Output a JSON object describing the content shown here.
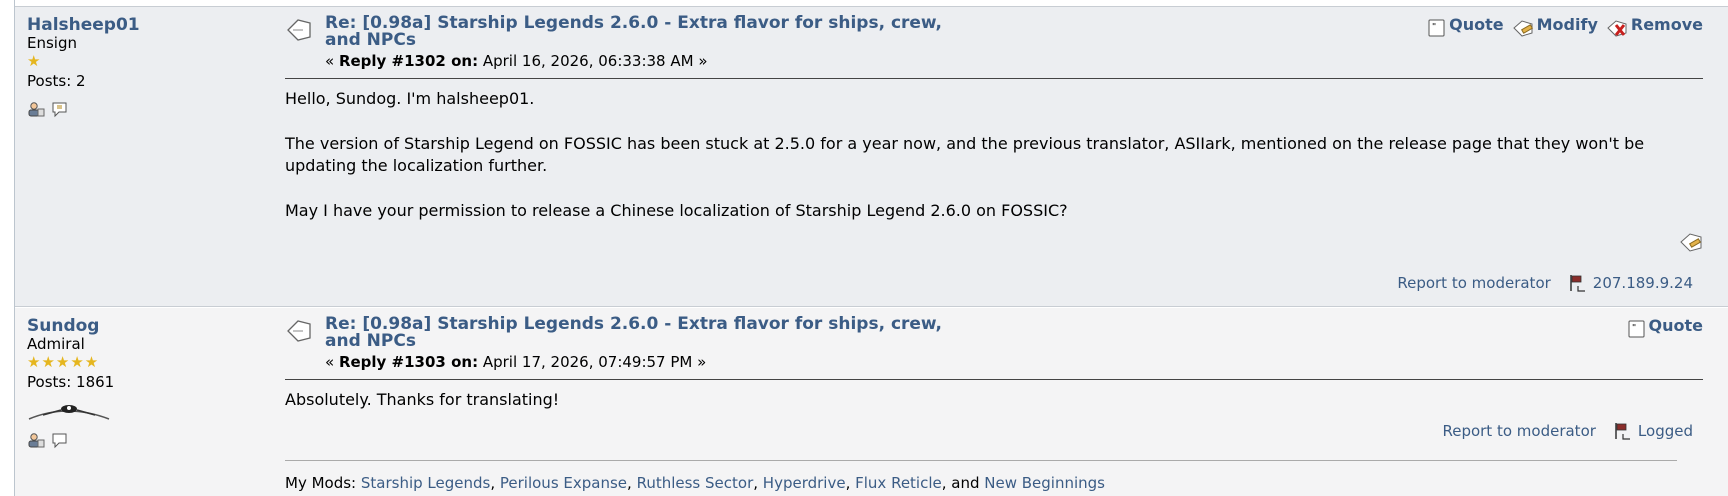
{
  "posts": [
    {
      "poster": {
        "name": "Halsheep01",
        "rank": "Ensign",
        "stars": "★",
        "posts": "Posts: 2"
      },
      "subject": "Re: [0.98a] Starship Legends 2.6.0 - Extra flavor for ships, crew, and NPCs",
      "reply_prefix": "« ",
      "reply_label": "Reply #1302 on:",
      "reply_date": " April 16, 2026, 06:33:38 AM »",
      "actions": {
        "quote": "Quote",
        "modify": "Modify",
        "remove": "Remove"
      },
      "body": [
        "Hello, Sundog. I'm halsheep01.",
        "The version of Starship Legend on FOSSIC has been stuck at 2.5.0 for a year now, and the previous translator, ASIIark, mentioned on the release page that they won't be updating the localization further.",
        "May I have your permission to release a Chinese localization of Starship Legend 2.6.0 on FOSSIC?"
      ],
      "report": "Report to moderator",
      "ip": "207.189.9.24"
    },
    {
      "poster": {
        "name": "Sundog",
        "rank": "Admiral",
        "stars": "★★★★★",
        "posts": "Posts: 1861"
      },
      "subject": "Re: [0.98a] Starship Legends 2.6.0 - Extra flavor for ships, crew, and NPCs",
      "reply_prefix": "« ",
      "reply_label": "Reply #1303 on:",
      "reply_date": " April 17, 2026, 07:49:57 PM »",
      "actions": {
        "quote": "Quote"
      },
      "body": [
        "Absolutely. Thanks for translating!"
      ],
      "report": "Report to moderator",
      "logged": "Logged",
      "signature": {
        "prefix": "My Mods: ",
        "mods": [
          "Starship Legends",
          "Perilous Expanse",
          "Ruthless Sector",
          "Hyperdrive",
          "Flux Reticle",
          "New Beginnings"
        ],
        "sep": ", ",
        "and": ", and "
      }
    }
  ],
  "colors": {
    "link": "#3b5c85",
    "star": "#e5b61f"
  }
}
